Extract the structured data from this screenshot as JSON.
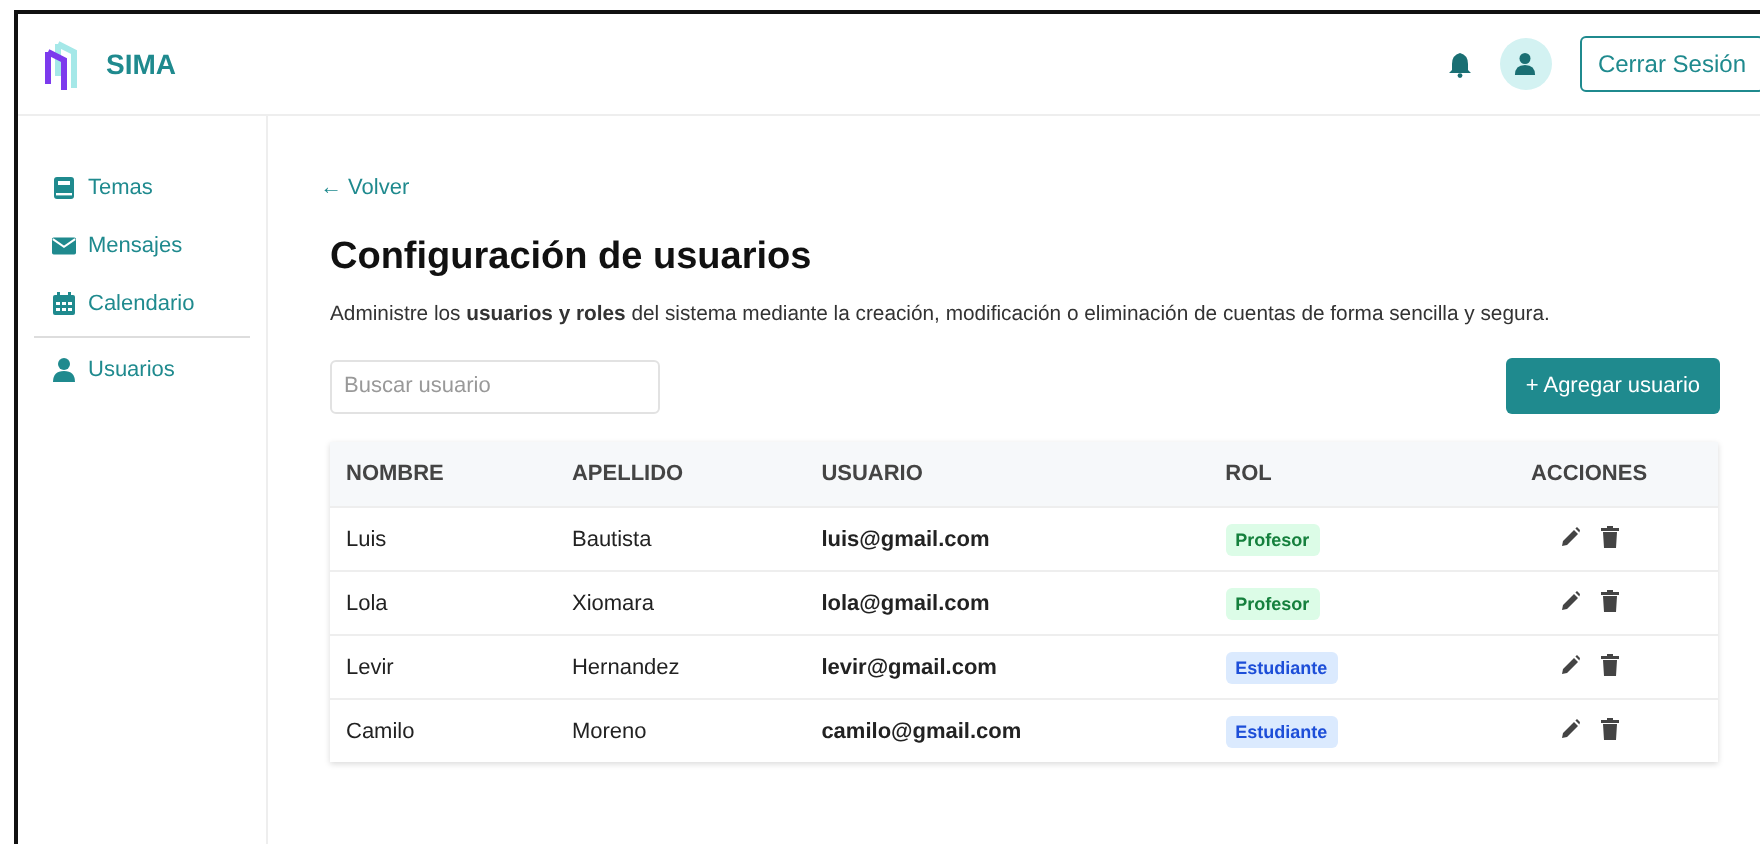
{
  "header": {
    "brand": "SIMA",
    "logout": "Cerrar Sesión"
  },
  "sidebar": {
    "sections": [
      {
        "items": [
          {
            "label": "Temas"
          },
          {
            "label": "Mensajes"
          },
          {
            "label": "Calendario"
          }
        ]
      },
      {
        "items": [
          {
            "label": "Usuarios"
          }
        ]
      }
    ]
  },
  "back_link": "← Volver",
  "title": "Configuración de usuarios",
  "description": "Administre los **usuarios y roles** del sistema mediante la creación, modificación o eliminación de cuentas de forma sencilla y segura.",
  "search": {
    "placeholder": "Buscar usuario"
  },
  "add_button": "+ Agregar usuario",
  "table": {
    "columns": [
      "NOMBRE",
      "APELLIDO",
      "USUARIO",
      "ROL",
      "ACCIONES"
    ],
    "rows": [
      {
        "nombre": "Luis",
        "apellido": "Bautista",
        "usuario": "luis@gmail.com",
        "rol": {
          "label": "Profesor",
          "kind": "teacher"
        }
      },
      {
        "nombre": "Lola",
        "apellido": "Xiomara",
        "usuario": "lola@gmail.com",
        "rol": {
          "label": "Profesor",
          "kind": "teacher"
        }
      },
      {
        "nombre": "Levir",
        "apellido": "Hernandez",
        "usuario": "levir@gmail.com",
        "rol": {
          "label": "Estudiante",
          "kind": "student"
        }
      },
      {
        "nombre": "Camilo",
        "apellido": "Moreno",
        "usuario": "camilo@gmail.com",
        "rol": {
          "label": "Estudiante",
          "kind": "student"
        }
      }
    ]
  }
}
